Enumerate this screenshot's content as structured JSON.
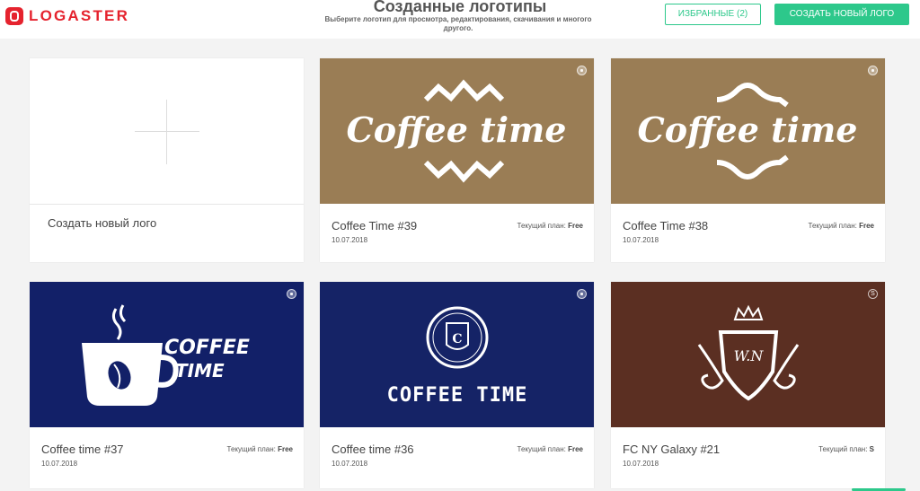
{
  "header": {
    "logo_text": "LOGASTER",
    "title": "Созданные логотипы",
    "subtitle": "Выберите логотип для просмотра, редактирования, скачивания и многого другого.",
    "favorites_label": "ИЗБРАННЫЕ (2)",
    "create_label": "СОЗДАТЬ НОВЫЙ ЛОГО"
  },
  "new_logo_card": {
    "label": "Создать новый лого"
  },
  "plan_prefix": "Текущий план:",
  "cards": [
    {
      "title": "Coffee Time #39",
      "date": "10.07.2018",
      "plan": "Free",
      "logo_text": "Coffee time",
      "bg": "#9a7d55",
      "badge": "lock-icon"
    },
    {
      "title": "Coffee Time #38",
      "date": "10.07.2018",
      "plan": "Free",
      "logo_text": "Coffee time",
      "bg": "#9a7d55",
      "badge": "lock-icon"
    },
    {
      "title": "Coffee time #37",
      "date": "10.07.2018",
      "plan": "Free",
      "logo_text_1": "COFFEE",
      "logo_text_2": "TIME",
      "bg": "#122068",
      "badge": "lock-icon"
    },
    {
      "title": "Coffee time #36",
      "date": "10.07.2018",
      "plan": "Free",
      "logo_text": "COFFEE TIME",
      "emblem_letter": "C",
      "bg": "#152366",
      "badge": "lock-icon"
    },
    {
      "title": "FC NY Galaxy #21",
      "date": "10.07.2018",
      "plan": "S",
      "logo_text": "W.N",
      "badge_text": "S",
      "bg": "#5b2f22",
      "badge": "s-badge"
    }
  ],
  "colors": {
    "accent": "#2dc88b",
    "brand": "#e5232e"
  }
}
